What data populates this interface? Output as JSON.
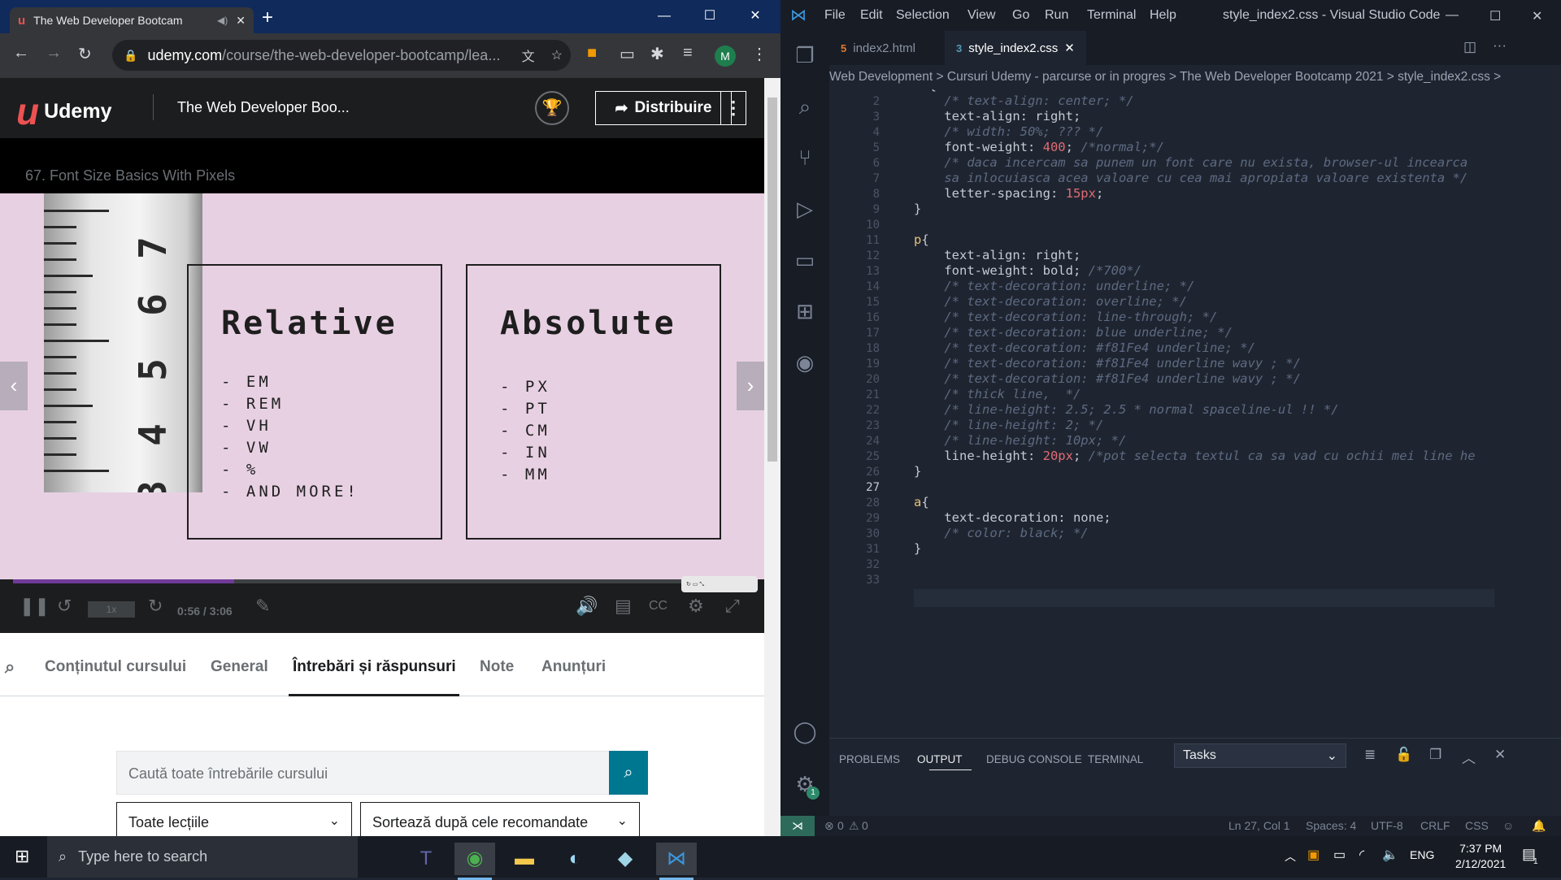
{
  "chrome": {
    "tab_title": "The Web Developer Bootcam",
    "url_host": "udemy.com",
    "url_path": "/course/the-web-developer-bootcamp/lea...",
    "profile_initial": "M"
  },
  "udemy": {
    "logo": "Udemy",
    "course_title": "The Web Developer Boo...",
    "share_label": "Distribuire",
    "lecture_title": "67. Font Size Basics With Pixels",
    "slide": {
      "relative_title": "Relative",
      "relative_items": [
        "-  EM",
        "-  REM",
        "-  VH",
        "-  VW",
        "-  %",
        "-  AND MORE!"
      ],
      "absolute_title": "Absolute",
      "absolute_items": [
        "-  PX",
        "-  PT",
        "-  CM",
        "-  IN",
        "-  MM"
      ]
    },
    "player": {
      "speed": "1x",
      "time": "0:56 / 3:06",
      "progress": 0.3
    },
    "tabs": [
      "Conținutul cursului",
      "General",
      "Întrebări și răspunsuri",
      "Note",
      "Anunțuri"
    ],
    "search_placeholder": "Caută toate întrebările cursului",
    "filter_lessons": "Toate lecțiile",
    "filter_sort": "Sortează după cele recomandate"
  },
  "vscode": {
    "menu": [
      "File",
      "Edit",
      "Selection",
      "View",
      "Go",
      "Run",
      "Terminal",
      "Help"
    ],
    "title": "style_index2.css - Visual Studio Code",
    "tabs": [
      "index2.html",
      "style_index2.css"
    ],
    "breadcrumb": "Web Development > Cursuri Udemy - parcurse or in progres > The Web Developer Bootcamp 2021 > style_index2.css >",
    "panel_tabs": [
      "PROBLEMS",
      "OUTPUT",
      "DEBUG CONSOLE",
      "TERMINAL"
    ],
    "task_select": "Tasks",
    "status": {
      "errors": "0",
      "warnings": "0",
      "position": "Ln 27, Col 1",
      "spaces": "Spaces: 4",
      "encoding": "UTF-8",
      "eol": "CRLF",
      "lang": "CSS"
    },
    "accounts_badge": "1"
  },
  "taskbar": {
    "search_placeholder": "Type here to search",
    "lang": "ENG",
    "time": "7:37 PM",
    "date": "2/12/2021",
    "notif_count": "1"
  },
  "colors": {
    "udemy_red": "#ec5252",
    "vscode_bg": "#1f2530",
    "slide_bg": "#e8d0e3",
    "search_btn": "#007791"
  }
}
